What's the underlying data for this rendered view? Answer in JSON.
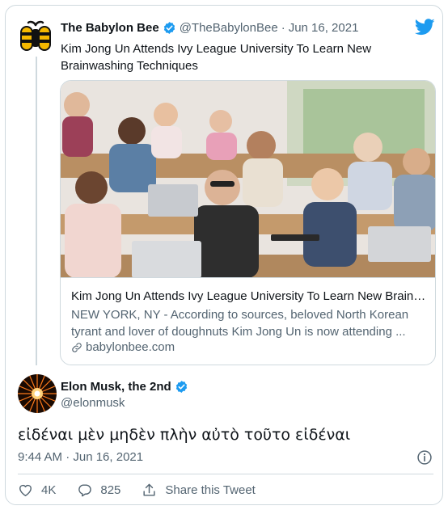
{
  "tweet1": {
    "name": "The Babylon Bee",
    "handle": "@TheBabylonBee",
    "separator": "·",
    "date": "Jun 16, 2021",
    "text": "Kim Jong Un Attends Ivy League University To Learn New Brainwashing Techniques",
    "link_card": {
      "title": "Kim Jong Un Attends Ivy League University To Learn New Brainw...",
      "description": "NEW YORK, NY - According to sources, beloved North Korean tyrant and lover of doughnuts Kim Jong Un is now attending ...",
      "domain": "babylonbee.com"
    }
  },
  "tweet2": {
    "name": "Elon Musk, the 2nd",
    "handle": "@elonmusk",
    "text": "εἰδέναι μὲν μηδὲν πλὴν αὐτὸ τοῦτο εἰδέναι",
    "timestamp": "9:44 AM · Jun 16, 2021"
  },
  "actions": {
    "likes": "4K",
    "replies": "825",
    "share_label": "Share this Tweet"
  },
  "colors": {
    "accent": "#1d9bf0",
    "text": "#0f1419",
    "secondary": "#536471",
    "border": "#cfd9de"
  },
  "icons": [
    "babylon-bee-logo-icon",
    "verified-badge-icon",
    "twitter-bird-icon",
    "link-icon",
    "info-icon",
    "heart-icon",
    "reply-icon",
    "share-icon"
  ]
}
